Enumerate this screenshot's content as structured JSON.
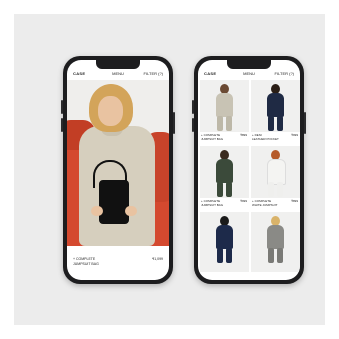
{
  "left_phone": {
    "status": {
      "logo": "CASE",
      "menu": "MENU",
      "right": "FILTER (?)"
    },
    "product": {
      "name_line1": "+ COMPLETE",
      "name_line2": "JUMPSUIT BAG",
      "price": "₹1,099"
    }
  },
  "right_phone": {
    "status": {
      "logo": "CASE",
      "menu": "MENU",
      "right": "FILTER (?)"
    },
    "products": [
      {
        "name1": "+ COMPLETE",
        "name2": "JUMPSUIT BAG",
        "price": "₹899"
      },
      {
        "name1": "+ DENI",
        "name2": "LEATHER POCKET",
        "price": "₹999"
      },
      {
        "name1": "+ COMPLETE",
        "name2": "JUMPSUIT BAG",
        "price": "₹999"
      },
      {
        "name1": "+ COMPLETE",
        "name2": "WHITE JUMPSUIT",
        "price": "₹899"
      },
      {
        "name1": "",
        "name2": "",
        "price": ""
      },
      {
        "name1": "",
        "name2": "",
        "price": ""
      }
    ]
  },
  "colors": {
    "backdrop": "#ececec",
    "phone_frame": "#1d1d1f",
    "chair": "#d4492f",
    "jumpsuit": "#d6cfbe",
    "bag": "#111111"
  }
}
